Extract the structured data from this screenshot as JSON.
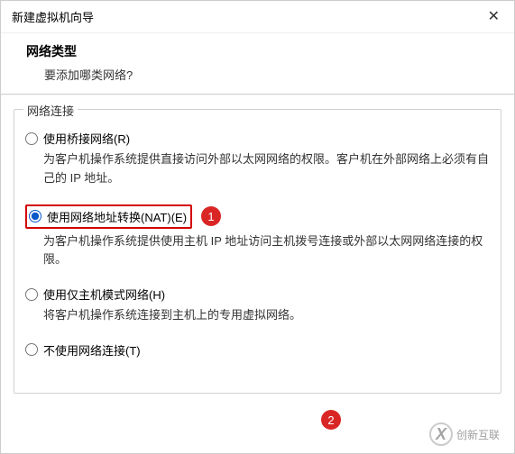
{
  "titlebar": {
    "title": "新建虚拟机向导"
  },
  "header": {
    "title": "网络类型",
    "subtitle": "要添加哪类网络?"
  },
  "group": {
    "title": "网络连接"
  },
  "options": {
    "bridged": {
      "label": "使用桥接网络(R)",
      "desc": "为客户机操作系统提供直接访问外部以太网网络的权限。客户机在外部网络上必须有自己的 IP 地址。"
    },
    "nat": {
      "label": "使用网络地址转换(NAT)(E)",
      "desc": "为客户机操作系统提供使用主机 IP 地址访问主机拨号连接或外部以太网网络连接的权限。"
    },
    "hostonly": {
      "label": "使用仅主机模式网络(H)",
      "desc": "将客户机操作系统连接到主机上的专用虚拟网络。"
    },
    "none": {
      "label": "不使用网络连接(T)"
    }
  },
  "badges": {
    "one": "1",
    "two": "2"
  },
  "watermark": {
    "text": "创新互联"
  }
}
